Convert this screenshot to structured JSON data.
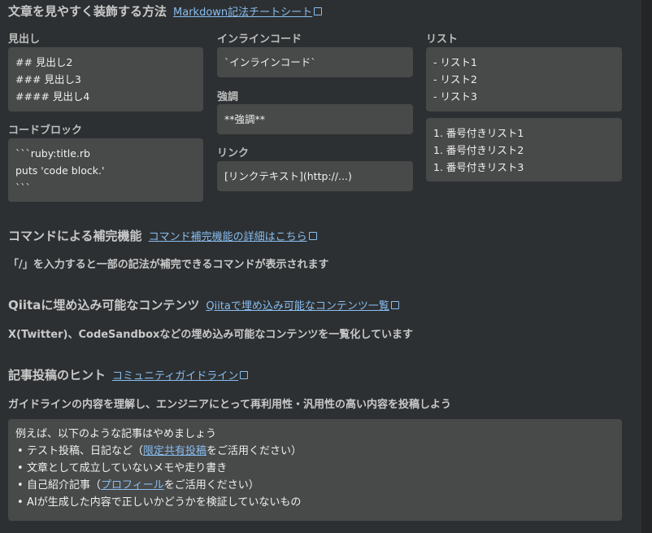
{
  "sec1": {
    "title": "文章を見やすく装飾する方法",
    "link": "Markdown記法チートシート",
    "heading_label": "見出し",
    "heading_lines": [
      "## 見出し2",
      "### 見出し3",
      "#### 見出し4"
    ],
    "codeblock_label": "コードブロック",
    "codeblock_lines": [
      "```ruby:title.rb",
      "puts 'code block.'",
      "```"
    ],
    "inline_label": "インラインコード",
    "inline_value": "`インラインコード`",
    "emphasis_label": "強調",
    "emphasis_value": "**強調**",
    "link_label": "リンク",
    "link_value": "[リンクテキスト](http://...)",
    "list_label": "リスト",
    "list_lines": [
      "- リスト1",
      "- リスト2",
      "- リスト3"
    ],
    "olist_lines": [
      "1. 番号付きリスト1",
      "1. 番号付きリスト2",
      "1. 番号付きリスト3"
    ]
  },
  "sec2": {
    "title": "コマンドによる補完機能",
    "link": "コマンド補完機能の詳細はこちら",
    "desc": "「/」を入力すると一部の記法が補完できるコマンドが表示されます"
  },
  "sec3": {
    "title": "Qiitaに埋め込み可能なコンテンツ",
    "link": "Qiitaで埋め込み可能なコンテンツ一覧",
    "desc": "X(Twitter)、CodeSandboxなどの埋め込み可能なコンテンツを一覧化しています"
  },
  "sec4": {
    "title": "記事投稿のヒント",
    "link": "コミュニティガイドライン",
    "desc": "ガイドラインの内容を理解し、エンジニアにとって再利用性・汎用性の高い内容を投稿しよう",
    "box_title": "例えば、以下のような記事はやめましょう",
    "item1_pre": "テスト投稿、日記など（",
    "item1_link": "限定共有投稿",
    "item1_post": "をご活用ください）",
    "item2": "文章として成立していないメモや走り書き",
    "item3_pre": "自己紹介記事（",
    "item3_link": "プロフィール",
    "item3_post": "をご活用ください）",
    "item4": "AIが生成した内容で正しいかどうかを検証していないもの"
  },
  "colors": {
    "background": "#2d3032",
    "box": "#484949",
    "link": "#88bdf0"
  }
}
